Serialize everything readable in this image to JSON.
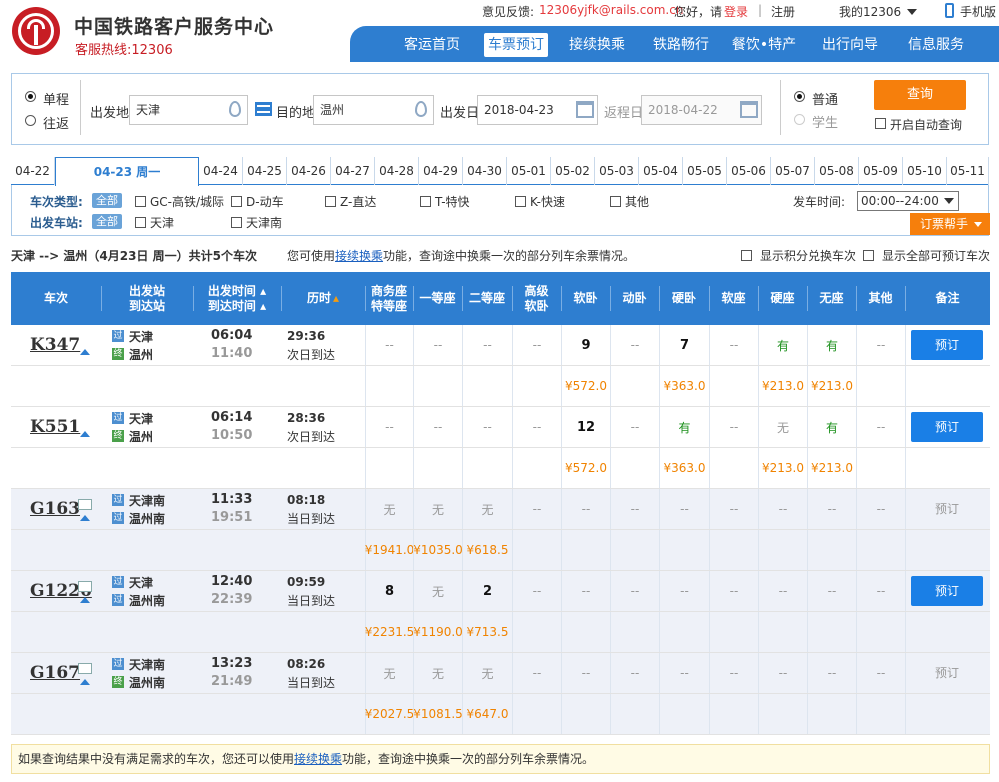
{
  "header": {
    "site_name": "中国铁路客户服务中心",
    "hotline": "客服热线:12306"
  },
  "topbar": {
    "feedback_label": "意见反馈:",
    "feedback_email": "12306yjfk@rails.com.cn",
    "greeting": "您好，请",
    "login": "登录",
    "sep": "|",
    "register": "注册",
    "my12306": "我的12306",
    "mobile": "手机版"
  },
  "nav": [
    "客运首页",
    "车票预订",
    "接续换乘",
    "铁路畅行",
    "餐饮•特产",
    "出行向导",
    "信息服务"
  ],
  "search": {
    "one_way": "单程",
    "round_trip": "往返",
    "from_label": "出发地",
    "from_value": "天津",
    "to_label": "目的地",
    "to_value": "温州",
    "depart_label": "出发日",
    "depart_value": "2018-04-23",
    "return_label": "返程日",
    "return_value": "2018-04-22",
    "normal": "普通",
    "student": "学生",
    "query_button": "查询",
    "auto_query": "开启自动查询"
  },
  "dates": [
    "04-22",
    "04-23 周一",
    "04-24",
    "04-25",
    "04-26",
    "04-27",
    "04-28",
    "04-29",
    "04-30",
    "05-01",
    "05-02",
    "05-03",
    "05-04",
    "05-05",
    "05-06",
    "05-07",
    "05-08",
    "05-09",
    "05-10",
    "05-11"
  ],
  "filters": {
    "type_label": "车次类型:",
    "all": "全部",
    "types": [
      "GC-高铁/城际",
      "D-动车",
      "Z-直达",
      "T-特快",
      "K-快速",
      "其他"
    ],
    "station_label": "出发车站:",
    "stations": [
      "天津",
      "天津南"
    ],
    "time_label": "发车时间:",
    "time_value": "00:00--24:00",
    "helper": "订票帮手"
  },
  "summary": {
    "route": "天津 --> 温州（4月23日 周一）共计5个车次",
    "hint_pre": "您可使用",
    "hint_link": "接续换乘",
    "hint_post": "功能，查询途中换乘一次的部分列车余票情况。",
    "opt1": "显示积分兑换车次",
    "opt2": "显示全部可预订车次"
  },
  "columns": {
    "train": "车次",
    "station1": "出发站",
    "station2": "到达站",
    "time1": "出发时间",
    "time2": "到达时间",
    "duration": "历时",
    "biz1": "商务座",
    "biz2": "特等座",
    "first": "一等座",
    "second": "二等座",
    "adv1": "高级",
    "adv2": "软卧",
    "soft": "软卧",
    "moving": "动卧",
    "hard": "硬卧",
    "softseat": "软座",
    "hardseat": "硬座",
    "noseat": "无座",
    "other": "其他",
    "remark": "备注"
  },
  "trains": [
    {
      "no": "K347",
      "from": "天津",
      "to": "温州",
      "dep": "06:04",
      "arr": "11:40",
      "dur": "29:36",
      "arrive_day": "次日到达",
      "seats": [
        "--",
        "--",
        "--",
        "--",
        "9",
        "--",
        "7",
        "--",
        "有",
        "有",
        "--"
      ],
      "prices": [
        "",
        "",
        "",
        "",
        "¥572.0",
        "",
        "¥363.0",
        "",
        "¥213.0",
        "¥213.0",
        ""
      ],
      "book": "预订"
    },
    {
      "no": "K551",
      "from": "天津",
      "to": "温州",
      "dep": "06:14",
      "arr": "10:50",
      "dur": "28:36",
      "arrive_day": "次日到达",
      "seats": [
        "--",
        "--",
        "--",
        "--",
        "12",
        "--",
        "有",
        "--",
        "无",
        "有",
        "--"
      ],
      "prices": [
        "",
        "",
        "",
        "",
        "¥572.0",
        "",
        "¥363.0",
        "",
        "¥213.0",
        "¥213.0",
        ""
      ],
      "book": "预订"
    },
    {
      "no": "G163",
      "from": "天津南",
      "to": "温州南",
      "dep": "11:33",
      "arr": "19:51",
      "dur": "08:18",
      "arrive_day": "当日到达",
      "seats": [
        "无",
        "无",
        "无",
        "--",
        "--",
        "--",
        "--",
        "--",
        "--",
        "--",
        "--"
      ],
      "prices": [
        "¥1941.0",
        "¥1035.0",
        "¥618.5",
        "",
        "",
        "",
        "",
        "",
        "",
        "",
        ""
      ],
      "book": "预订"
    },
    {
      "no": "G1226",
      "from": "天津",
      "to": "温州南",
      "dep": "12:40",
      "arr": "22:39",
      "dur": "09:59",
      "arrive_day": "当日到达",
      "seats": [
        "8",
        "无",
        "2",
        "--",
        "--",
        "--",
        "--",
        "--",
        "--",
        "--",
        "--"
      ],
      "prices": [
        "¥2231.5",
        "¥1190.0",
        "¥713.5",
        "",
        "",
        "",
        "",
        "",
        "",
        "",
        ""
      ],
      "book": "预订"
    },
    {
      "no": "G167",
      "from": "天津南",
      "to": "温州南",
      "dep": "13:23",
      "arr": "21:49",
      "dur": "08:26",
      "arrive_day": "当日到达",
      "seats": [
        "无",
        "无",
        "无",
        "--",
        "--",
        "--",
        "--",
        "--",
        "--",
        "--",
        "--"
      ],
      "prices": [
        "¥2027.5",
        "¥1081.5",
        "¥647.0",
        "",
        "",
        "",
        "",
        "",
        "",
        "",
        ""
      ],
      "book": "预订"
    }
  ],
  "notice": {
    "pre": "如果查询结果中没有满足需求的车次，您还可以使用",
    "link": "接续换乘",
    "post": "功能，查询途中换乘一次的部分列车余票情况。"
  }
}
